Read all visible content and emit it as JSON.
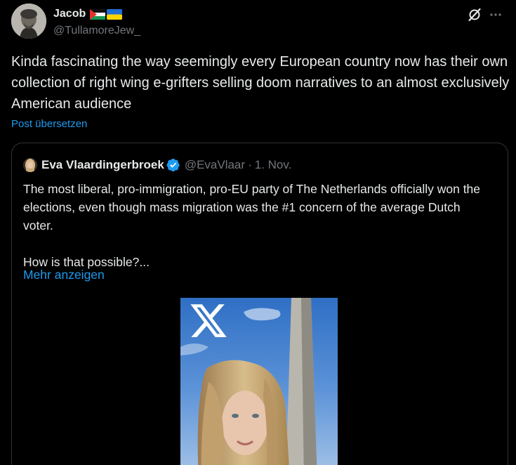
{
  "author": {
    "display_name": "Jacob",
    "handle": "@TullamoreJew_",
    "flags": [
      "palestine-flag-icon",
      "ukraine-flag-icon"
    ]
  },
  "actions": {
    "grok_icon": "grok-icon",
    "more_icon": "more-icon"
  },
  "post": {
    "text": "Kinda fascinating the way seemingly every European country now has their own collection of right wing e-grifters selling doom narratives to an almost exclusively American audience",
    "translate_label": "Post übersetzen"
  },
  "quoted_post": {
    "display_name": "Eva Vlaardingerbroek",
    "verified": true,
    "handle": "@EvaVlaar",
    "separator": "·",
    "date": "1. Nov.",
    "text": "The most liberal, pro-immigration, pro-EU party of The Netherlands officially won the elections, even though mass migration was the #1 concern of the average Dutch voter.\n\nHow is that possible?...",
    "show_more_label": "Mehr anzeigen",
    "media": {
      "type": "video-thumbnail",
      "logo": "x-logo-icon"
    }
  },
  "colors": {
    "background": "#000000",
    "text": "#e7e9ea",
    "secondary": "#71767b",
    "link": "#1d9bf0",
    "border": "#2f3336"
  }
}
